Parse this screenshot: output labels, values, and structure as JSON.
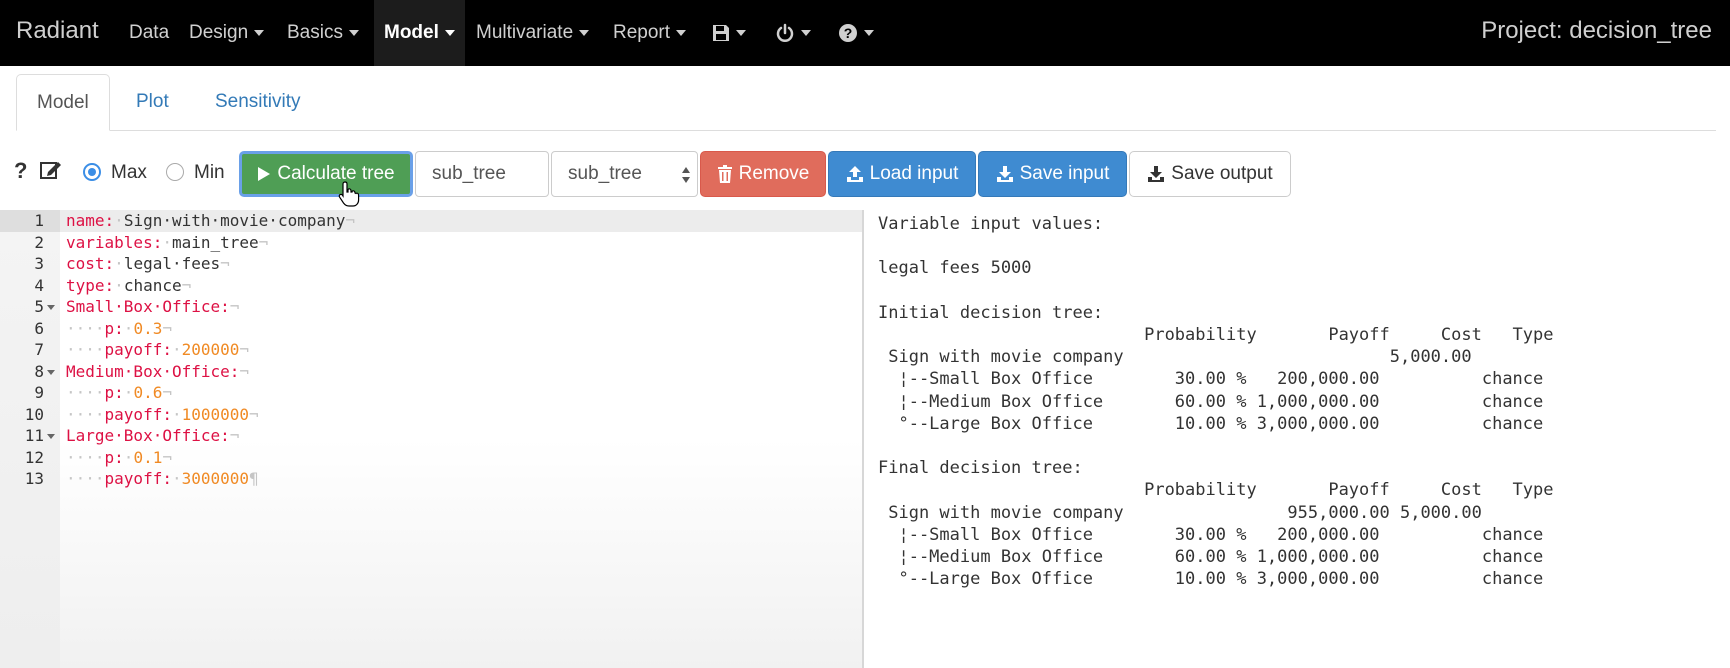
{
  "navbar": {
    "brand": "Radiant",
    "items": [
      "Data",
      "Design",
      "Basics",
      "Model",
      "Multivariate",
      "Report"
    ],
    "active": "Model",
    "icons": [
      "save-icon",
      "power-icon",
      "help-icon"
    ],
    "project": "Project: decision_tree"
  },
  "tabs": [
    "Model",
    "Plot",
    "Sensitivity"
  ],
  "toolbar": {
    "help": "?",
    "radio_max": "Max",
    "radio_min": "Min",
    "selected": "Max",
    "calculate": "Calculate tree",
    "name_input": "sub_tree",
    "select_value": "sub_tree",
    "remove": "Remove",
    "load": "Load input",
    "save": "Save input",
    "save_output": "Save output"
  },
  "editor": {
    "lines": [
      {
        "n": "1",
        "indent": "",
        "key": "name:",
        "val": "Sign·with·movie·company",
        "kind": "str",
        "end": "¬"
      },
      {
        "n": "2",
        "indent": "",
        "key": "variables:",
        "val": "main_tree",
        "kind": "str",
        "end": "¬"
      },
      {
        "n": "3",
        "indent": "",
        "key": "cost:",
        "val": "legal·fees",
        "kind": "str",
        "end": "¬"
      },
      {
        "n": "4",
        "indent": "",
        "key": "type:",
        "val": "chance",
        "kind": "str",
        "end": "¬"
      },
      {
        "n": "5",
        "indent": "",
        "key": "Small·Box·Office:",
        "val": "",
        "kind": "str",
        "end": "¬"
      },
      {
        "n": "6",
        "indent": "····",
        "key": "p:",
        "val": "0.3",
        "kind": "num",
        "end": "¬"
      },
      {
        "n": "7",
        "indent": "····",
        "key": "payoff:",
        "val": "200000",
        "kind": "num",
        "end": "¬"
      },
      {
        "n": "8",
        "indent": "",
        "key": "Medium·Box·Office:",
        "val": "",
        "kind": "str",
        "end": "¬"
      },
      {
        "n": "9",
        "indent": "····",
        "key": "p:",
        "val": "0.6",
        "kind": "num",
        "end": "¬"
      },
      {
        "n": "10",
        "indent": "····",
        "key": "payoff:",
        "val": "1000000",
        "kind": "num",
        "end": "¬"
      },
      {
        "n": "11",
        "indent": "",
        "key": "Large·Box·Office:",
        "val": "",
        "kind": "str",
        "end": "¬"
      },
      {
        "n": "12",
        "indent": "····",
        "key": "p:",
        "val": "0.1",
        "kind": "num",
        "end": "¬"
      },
      {
        "n": "13",
        "indent": "····",
        "key": "payoff:",
        "val": "3000000",
        "kind": "num",
        "end": "¶"
      }
    ],
    "fold_lines": [
      "5",
      "8",
      "11"
    ]
  },
  "output": {
    "lines": [
      "Variable input values:",
      "",
      "legal fees 5000",
      "",
      "Initial decision tree:",
      "                          Probability       Payoff     Cost   Type",
      " Sign with movie company                          5,000.00",
      "  ¦--Small Box Office        30.00 %   200,000.00          chance",
      "  ¦--Medium Box Office       60.00 % 1,000,000.00          chance",
      "  °--Large Box Office        10.00 % 3,000,000.00          chance",
      "",
      "Final decision tree:",
      "                          Probability       Payoff     Cost   Type",
      " Sign with movie company                955,000.00 5,000.00",
      "  ¦--Small Box Office        30.00 %   200,000.00          chance",
      "  ¦--Medium Box Office       60.00 % 1,000,000.00          chance",
      "  °--Large Box Office        10.00 % 3,000,000.00          chance"
    ]
  }
}
